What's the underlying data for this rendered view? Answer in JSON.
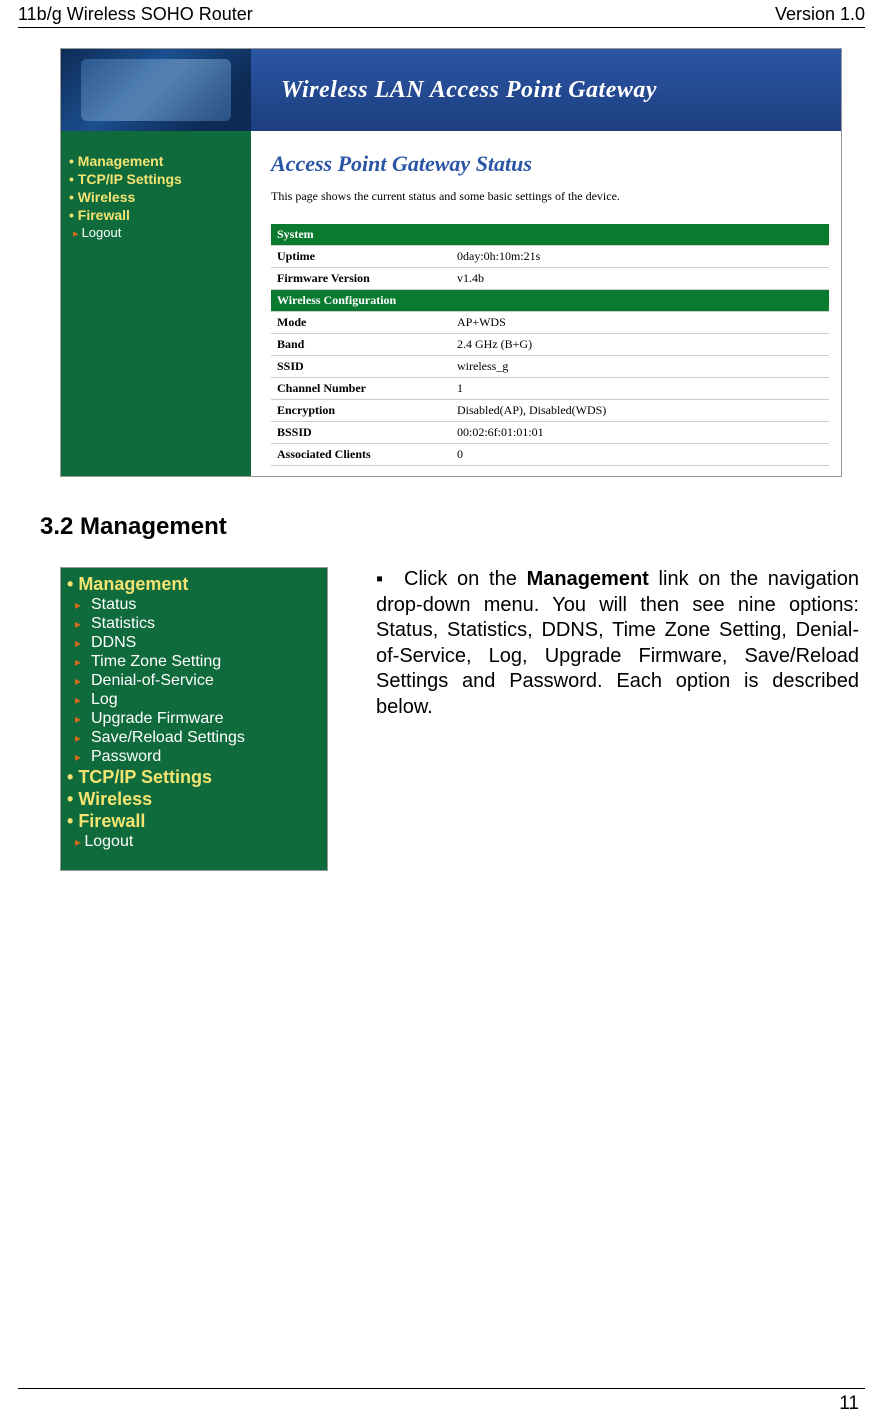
{
  "header": {
    "left": "11b/g Wireless SOHO Router",
    "right": "Version 1.0"
  },
  "shot1": {
    "banner": "Wireless LAN Access Point Gateway",
    "nav_top": [
      "Management",
      "TCP/IP Settings",
      "Wireless",
      "Firewall"
    ],
    "nav_sub": "Logout",
    "content_title": "Access Point Gateway Status",
    "content_desc": "This page shows the current status and some basic settings of the device.",
    "sections": [
      {
        "section": "System"
      },
      {
        "label": "Uptime",
        "value": "0day:0h:10m:21s"
      },
      {
        "label": "Firmware Version",
        "value": "v1.4b"
      },
      {
        "section": "Wireless Configuration"
      },
      {
        "label": "Mode",
        "value": "AP+WDS"
      },
      {
        "label": "Band",
        "value": "2.4 GHz (B+G)"
      },
      {
        "label": "SSID",
        "value": "wireless_g"
      },
      {
        "label": "Channel Number",
        "value": "1"
      },
      {
        "label": "Encryption",
        "value": "Disabled(AP), Disabled(WDS)"
      },
      {
        "label": "BSSID",
        "value": "00:02:6f:01:01:01"
      },
      {
        "label": "Associated Clients",
        "value": "0"
      }
    ]
  },
  "section_heading": "3.2  Management",
  "shot2": {
    "expanded": "Management",
    "children": [
      "Status",
      "Statistics",
      "DDNS",
      "Time Zone Setting",
      "Denial-of-Service",
      "Log",
      "Upgrade Firmware",
      "Save/Reload Settings",
      "Password"
    ],
    "collapsed": [
      "TCP/IP Settings",
      "Wireless",
      "Firewall"
    ],
    "logout": "Logout"
  },
  "paragraph": {
    "pre": "Click on the ",
    "bold": "Management",
    "post": " link on the navigation drop-down menu. You will then see nine options: Status, Statistics, DDNS, Time Zone Setting, Denial-of-Service, Log, Upgrade Firmware, Save/Reload Settings and Password. Each option is described below."
  },
  "footer": {
    "page": "11"
  }
}
